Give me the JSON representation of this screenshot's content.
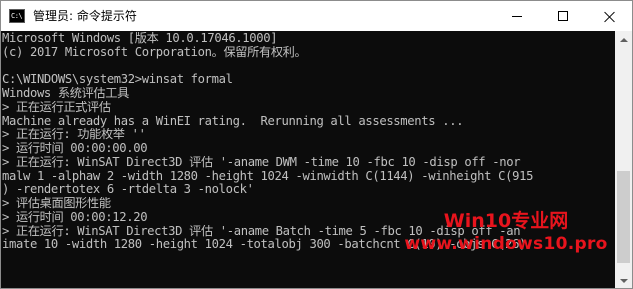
{
  "window": {
    "title": "管理员: 命令提示符",
    "icon_text": "C:\\"
  },
  "console": {
    "lines": [
      "Microsoft Windows [版本 10.0.17046.1000]",
      "(c) 2017 Microsoft Corporation。保留所有权利。",
      "",
      "C:\\WINDOWS\\system32>winsat formal",
      "Windows 系统评估工具",
      "> 正在运行正式评估",
      "Machine already has a WinEI rating.  Rerunning all assessments ...",
      "> 正在运行: 功能枚举 ''",
      "> 运行时间 00:00:00.00",
      "> 正在运行: WinSAT Direct3D 评估 '-aname DWM -time 10 -fbc 10 -disp off -nor",
      "malw 1 -alphaw 2 -width 1280 -height 1024 -winwidth C(1144) -winheight C(915",
      ") -rendertotex 6 -rtdelta 3 -nolock'",
      "> 评估桌面图形性能",
      "> 运行时间 00:00:12.20",
      "> 正在运行: WinSAT Direct3D 评估 '-aname Batch -time 5 -fbc 10 -disp off -an",
      "imate 10 -width 1280 -height 1024 -totalobj 300 -batchcnt C(10) -objs C(26)"
    ]
  },
  "watermark": {
    "line1": "Win10专业网",
    "line2": "www.windows10.pro"
  },
  "colors": {
    "console_bg": "#0c0c0c",
    "console_text": "#c0c0c0",
    "watermark": "#e8141d"
  },
  "icons": {
    "app": "cmd-icon",
    "minimize": "minimize-icon",
    "maximize": "maximize-icon",
    "close": "close-icon"
  }
}
